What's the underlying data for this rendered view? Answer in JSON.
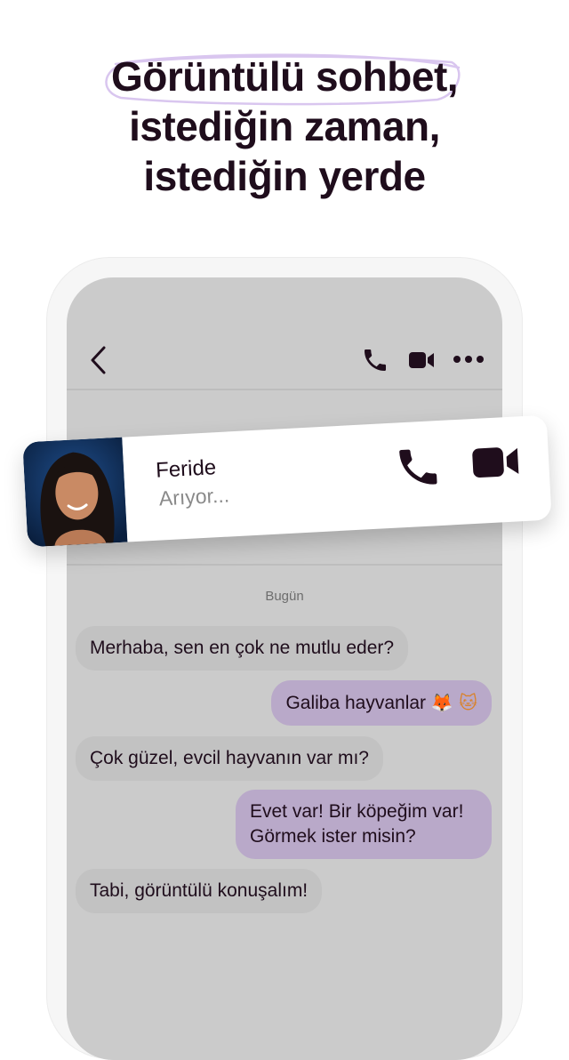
{
  "headline": {
    "line1": "Görüntülü sohbet,",
    "line2": "istediğin zaman,",
    "line3": "istediğin yerde"
  },
  "chat_header": {
    "icons": [
      "back-chevron-icon",
      "phone-icon",
      "video-camera-icon",
      "more-dots-icon"
    ]
  },
  "incoming_call": {
    "name": "Feride",
    "status": "Arıyor...",
    "icons": [
      "phone-icon",
      "video-camera-icon"
    ]
  },
  "conversation": {
    "date_label": "Bugün",
    "messages": [
      {
        "direction": "in",
        "text": "Merhaba, sen en çok ne mutlu eder?"
      },
      {
        "direction": "out",
        "text": "Galiba hayvanlar",
        "emoji": "🦊 🐱"
      },
      {
        "direction": "in",
        "text": "Çok güzel, evcil hayvanın var mı?"
      },
      {
        "direction": "out",
        "text": "Evet var! Bir köpeğim var!",
        "text2": "Görmek ister misin?"
      },
      {
        "direction": "in",
        "text": "Tabi, görüntülü konuşalım!"
      }
    ]
  },
  "colors": {
    "text": "#1f0d1c",
    "outgoing_bubble": "#b9a9c9",
    "incoming_bubble": "#c2c2c2",
    "screen_background": "#cbcbcb",
    "headline_scribble": "#d9c6ef"
  }
}
